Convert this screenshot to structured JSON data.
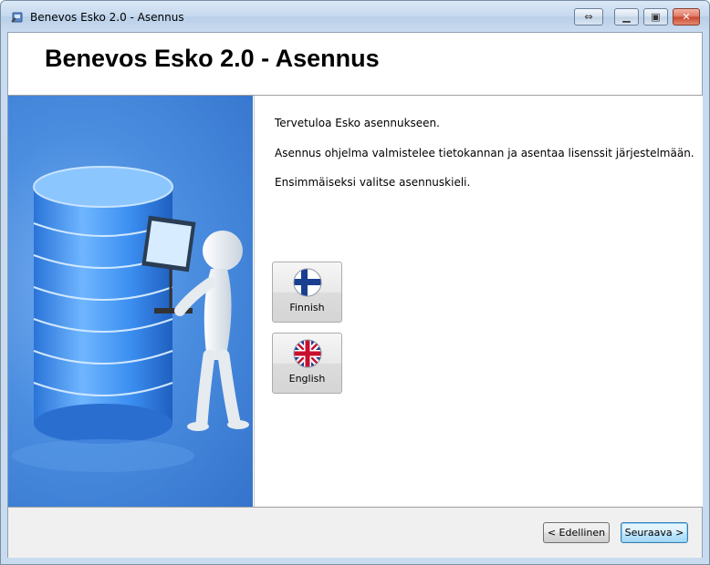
{
  "window": {
    "title": "Benevos Esko 2.0 - Asennus"
  },
  "header": {
    "title": "Benevos Esko 2.0 - Asennus"
  },
  "content": {
    "welcome": "Tervetuloa Esko asennukseen.",
    "description": "Asennus ohjelma valmistelee tietokannan ja asentaa lisenssit järjestelmään.",
    "instruction": "Ensimmäiseksi valitse asennuskieli."
  },
  "languages": [
    {
      "label": "Finnish",
      "icon": "finland-flag-icon"
    },
    {
      "label": "English",
      "icon": "uk-flag-icon"
    }
  ],
  "footer": {
    "back_label": "< Edellinen",
    "next_label": "Seuraava >"
  },
  "colors": {
    "side_panel": "#4b8ee0",
    "titlebar": "#c5d8ee",
    "default_button_border": "#3c7fb1"
  }
}
